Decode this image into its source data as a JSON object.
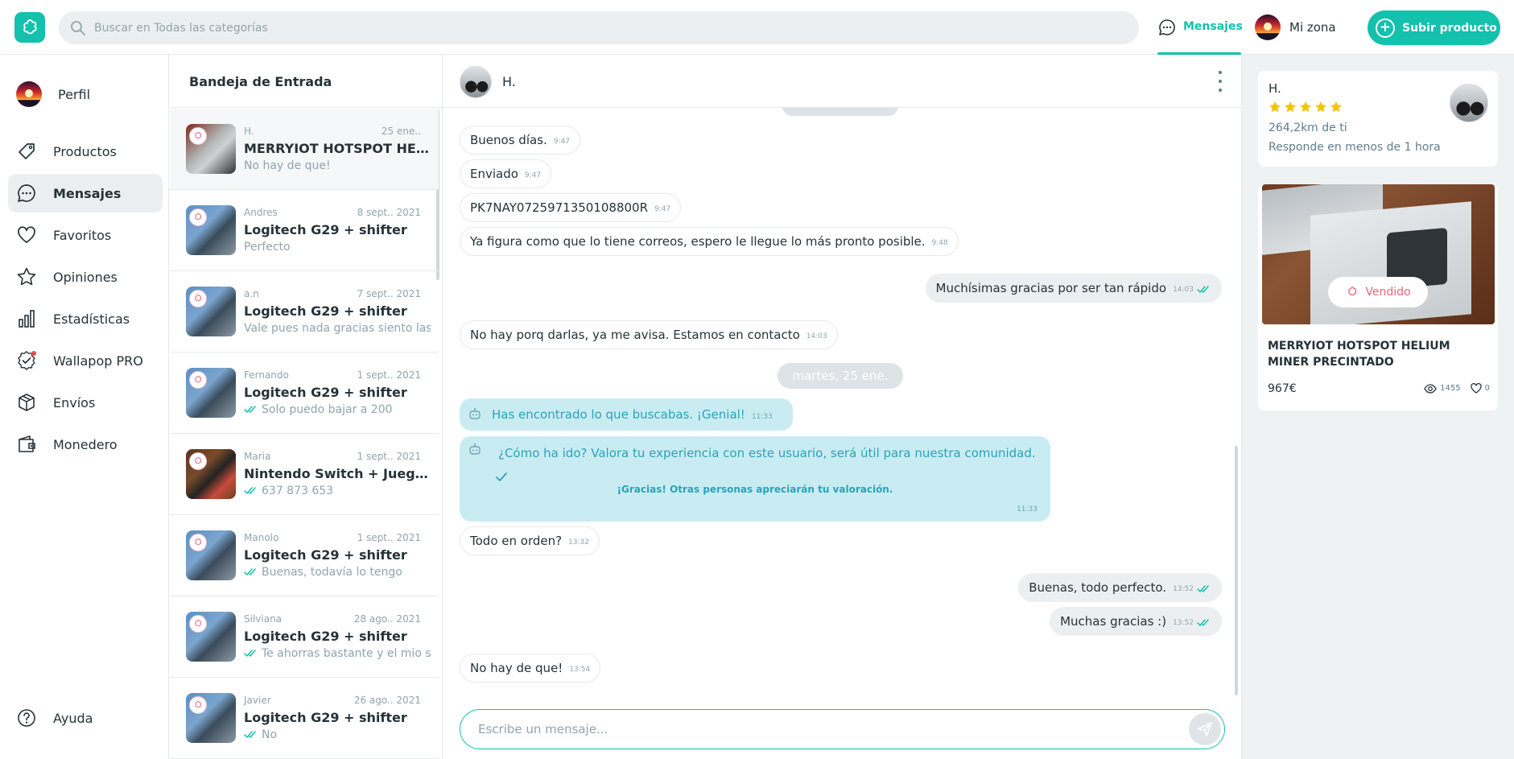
{
  "colors": {
    "accent": "#13c1ac",
    "system_bubble": "#c9ecf3",
    "sold": "#f0647e",
    "star": "#f5c400"
  },
  "header": {
    "search_placeholder": "Buscar en Todas las categorías",
    "messages_label": "Mensajes",
    "my_zone_label": "Mi zona",
    "upload_label": "Subir producto"
  },
  "sidebar": {
    "items": [
      {
        "label": "Perfil",
        "icon": "profile-avatar"
      },
      {
        "label": "Productos",
        "icon": "tag-icon"
      },
      {
        "label": "Mensajes",
        "icon": "chat-bubble-icon",
        "active": true
      },
      {
        "label": "Favoritos",
        "icon": "heart-icon"
      },
      {
        "label": "Opiniones",
        "icon": "star-icon"
      },
      {
        "label": "Estadísticas",
        "icon": "bar-chart-icon"
      },
      {
        "label": "Wallapop PRO",
        "icon": "pro-badge-icon"
      },
      {
        "label": "Envíos",
        "icon": "box-icon"
      },
      {
        "label": "Monedero",
        "icon": "wallet-icon"
      }
    ],
    "help_label": "Ayuda"
  },
  "inbox": {
    "title": "Bandeja de Entrada",
    "conversations": [
      {
        "user": "H.",
        "date": "25 ene..",
        "title": "MERRYIOT HOTSPOT HELIU...",
        "snippet": "No hay de que!",
        "read_check": false
      },
      {
        "user": "Andres",
        "date": "8 sept.. 2021",
        "title": "Logitech G29 + shifter",
        "snippet": "Perfecto",
        "read_check": false
      },
      {
        "user": "a.n",
        "date": "7 sept.. 2021",
        "title": "Logitech G29 + shifter",
        "snippet": "Vale pues nada gracias siento las r",
        "read_check": false
      },
      {
        "user": "Fernando",
        "date": "1 sept.. 2021",
        "title": "Logitech G29 + shifter",
        "snippet": "Solo puedo bajar a 200",
        "read_check": true
      },
      {
        "user": "Maria",
        "date": "1 sept.. 2021",
        "title": "Nintendo Switch + Juegos +...",
        "snippet": "637 873 653",
        "read_check": true
      },
      {
        "user": "Manolo",
        "date": "1 sept.. 2021",
        "title": "Logitech G29 + shifter",
        "snippet": "Buenas, todavía lo tengo",
        "read_check": true
      },
      {
        "user": "Silviana",
        "date": "28 ago.. 2021",
        "title": "Logitech G29 + shifter",
        "snippet": "Te ahorras bastante y el mio so",
        "read_check": true
      },
      {
        "user": "Javier",
        "date": "26 ago.. 2021",
        "title": "Logitech G29 + shifter",
        "snippet": "No",
        "read_check": true
      }
    ]
  },
  "chat": {
    "contact_name": "H.",
    "messages": [
      {
        "text": "Buenos días.",
        "time": "9:47",
        "outgoing": false
      },
      {
        "text": "Enviado",
        "time": "9:47",
        "outgoing": false
      },
      {
        "text": "PK7NAY0725971350108800R",
        "time": "9:47",
        "outgoing": false
      },
      {
        "text": "Ya figura como que lo tiene correos, espero le llegue lo más pronto posible.",
        "time": "9:48",
        "outgoing": false
      },
      {
        "text": "Muchísimas gracias por ser tan rápido",
        "time": "14:03",
        "outgoing": true
      },
      {
        "text": "No hay porq darlas, ya me avisa. Estamos en contacto",
        "time": "14:03",
        "outgoing": false
      },
      {
        "text": "Todo en orden?",
        "time": "13:32",
        "outgoing": false
      },
      {
        "text": "Buenas, todo perfecto.",
        "time": "13:52",
        "outgoing": true
      },
      {
        "text": "Muchas gracias :)",
        "time": "13:52",
        "outgoing": true
      },
      {
        "text": "No hay de que!",
        "time": "13:54",
        "outgoing": false
      }
    ],
    "date_separator": "martes, 25 ene.",
    "system_found": {
      "text": "Has encontrado lo que buscabas. ¡Genial!",
      "time": "11:33"
    },
    "system_review": {
      "text": "¿Cómo ha ido? Valora tu experiencia con este usuario, será útil para nuestra comunidad.",
      "confirmation": "¡Gracias! Otras personas apreciarán tu valoración.",
      "time": "11:33"
    },
    "input_placeholder": "Escribe un mensaje..."
  },
  "user_card": {
    "name": "H.",
    "rating_stars": 5,
    "distance": "264,2km de ti",
    "response": "Responde en menos de 1 hora"
  },
  "product_card": {
    "status": "Vendido",
    "title": "MERRYIOT HOTSPOT HELIUM MINER PRECINTADO",
    "price": "967€",
    "views": "1455",
    "likes": "0"
  }
}
